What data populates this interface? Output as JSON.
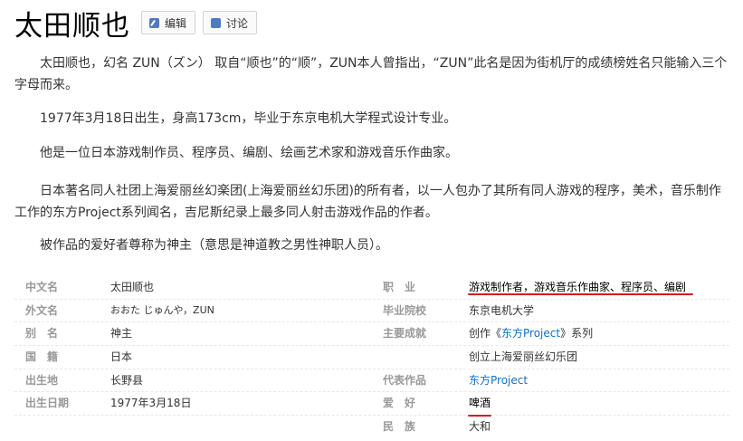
{
  "header": {
    "title": "太田顺也",
    "edit_label": "编辑",
    "discuss_label": "讨论"
  },
  "paragraphs": [
    "太田顺也，幻名 ZUN（ズン） 取自“顺也”的“顺”，ZUN本人曾指出，“ZUN”此名是因为街机厅的成绩榜姓名只能输入三个字母而来。",
    "1977年3月18日出生，身高173cm，毕业于东京电机大学程式设计专业。",
    "他是一位日本游戏制作员、程序员、编剧、绘画艺术家和游戏音乐作曲家。",
    "日本著名同人社团上海爱丽丝幻楽团(上海爱丽丝幻乐团)的所有者，以一人包办了其所有同人游戏的程序，美术，音乐制作工作的东方Project系列闻名，吉尼斯纪录上最多同人射击游戏作品的作者。",
    "被作品的爱好者尊称为神主（意思是神道教之男性神职人员）。"
  ],
  "infobox": {
    "left": [
      {
        "label": "中文名",
        "value": "太田顺也"
      },
      {
        "label": "外文名",
        "value": "おおた じゅんや，ZUN"
      },
      {
        "label": "别名",
        "value": "神主"
      },
      {
        "label": "国籍",
        "value": "日本"
      },
      {
        "label": "出生地",
        "value": "长野县"
      },
      {
        "label": "出生日期",
        "value": "1977年3月18日"
      }
    ],
    "right": [
      {
        "label": "职业",
        "value": "游戏制作者，游戏音乐作曲家、程序员、编剧"
      },
      {
        "label": "毕业院校",
        "value": "东京电机大学"
      },
      {
        "label": "主要成就",
        "value_pre": "创作《",
        "value_link": "东方Project",
        "value_post": "》系列"
      },
      {
        "label": "",
        "value": "创立上海爱丽丝幻乐团"
      },
      {
        "label": "代表作品",
        "value_link": "东方Project"
      },
      {
        "label": "爱好",
        "value": "啤酒"
      },
      {
        "label": "民族",
        "value": "大和"
      }
    ]
  },
  "colors": {
    "link": "#136ec2",
    "annotation_underline": "#d8191b",
    "label": "#999999"
  }
}
